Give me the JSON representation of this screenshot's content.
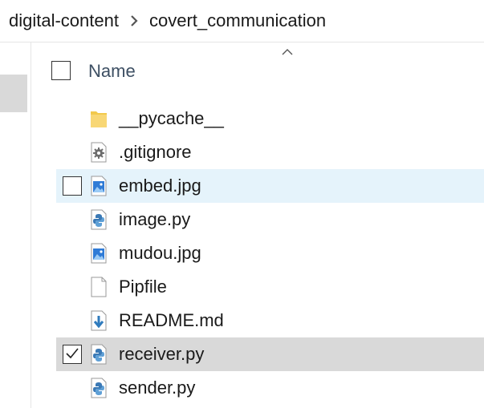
{
  "breadcrumb": {
    "items": [
      "digital-content",
      "covert_communication"
    ]
  },
  "header": {
    "name_column": "Name",
    "sort_direction": "ascending"
  },
  "files": [
    {
      "name": "__pycache__",
      "icon": "folder-icon",
      "state": "normal",
      "checked": false
    },
    {
      "name": ".gitignore",
      "icon": "settings-file-icon",
      "state": "normal",
      "checked": false
    },
    {
      "name": "embed.jpg",
      "icon": "image-file-icon",
      "state": "hover",
      "checked": false
    },
    {
      "name": "image.py",
      "icon": "python-file-icon",
      "state": "normal",
      "checked": false
    },
    {
      "name": "mudou.jpg",
      "icon": "image-file-icon",
      "state": "normal",
      "checked": false
    },
    {
      "name": "Pipfile",
      "icon": "blank-file-icon",
      "state": "normal",
      "checked": false
    },
    {
      "name": "README.md",
      "icon": "markdown-file-icon",
      "state": "normal",
      "checked": false
    },
    {
      "name": "receiver.py",
      "icon": "python-file-icon",
      "state": "selected",
      "checked": true
    },
    {
      "name": "sender.py",
      "icon": "python-file-icon",
      "state": "normal",
      "checked": false
    }
  ],
  "colors": {
    "hover_row": "#e5f3fb",
    "selected_row": "#d9d9d9",
    "folder": "#f2c94c",
    "image_blue": "#2f7bd6",
    "python_blue": "#3b79b5",
    "python_yellow": "#f5cc3d"
  }
}
